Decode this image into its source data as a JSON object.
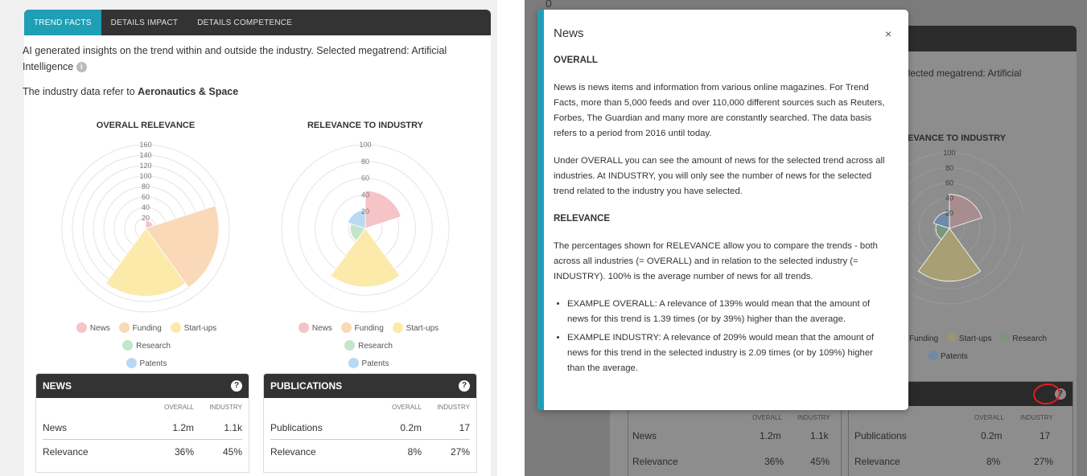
{
  "left": {
    "tabs": [
      {
        "label": "TREND FACTS",
        "active": true
      },
      {
        "label": "DETAILS IMPACT",
        "active": false
      },
      {
        "label": "DETAILS COMPETENCE",
        "active": false
      }
    ],
    "intro": "AI generated insights on the trend within and outside the industry. Selected megatrend: Artificial Intelligence",
    "info_icon": "i",
    "industry_prefix": "The industry data refer to ",
    "industry_name": "Aeronautics & Space",
    "chart_titles": {
      "overall": "OVERALL RELEVANCE",
      "industry": "RELEVANCE TO INDUSTRY"
    },
    "legend": [
      "News",
      "Funding",
      "Start-ups",
      "Research",
      "Patents"
    ],
    "news_box": {
      "title": "NEWS",
      "help_icon": "?",
      "col_overall": "OVERALL",
      "col_industry": "INDUSTRY",
      "rows": [
        {
          "label": "News",
          "overall": "1.2m",
          "industry": "1.1k"
        },
        {
          "label": "Relevance",
          "overall": "36%",
          "industry": "45%"
        }
      ]
    },
    "pub_box": {
      "title": "PUBLICATIONS",
      "help_icon": "?",
      "col_overall": "OVERALL",
      "col_industry": "INDUSTRY",
      "rows": [
        {
          "label": "Publications",
          "overall": "0.2m",
          "industry": "17"
        },
        {
          "label": "Relevance",
          "overall": "8%",
          "industry": "27%"
        }
      ]
    }
  },
  "colors": {
    "accent": "#1f9fb5",
    "news": "#f6c3c6",
    "funding": "#f9d9b8",
    "startups": "#fbeaa9",
    "research": "#c3e5c8",
    "patents": "#b9d8f2",
    "dark": "#333333"
  },
  "chart_data": [
    {
      "type": "polar-area",
      "title": "OVERALL RELEVANCE",
      "categories": [
        "News",
        "Funding",
        "Start-ups",
        "Research",
        "Patents"
      ],
      "values": [
        15,
        140,
        130,
        0,
        0
      ],
      "rlim": [
        0,
        160
      ],
      "ticks": [
        "20",
        "40",
        "60",
        "80",
        "100",
        "120",
        "140",
        "160"
      ]
    },
    {
      "type": "polar-area",
      "title": "RELEVANCE TO INDUSTRY",
      "categories": [
        "News",
        "Funding",
        "Start-ups",
        "Research",
        "Patents"
      ],
      "values": [
        45,
        0,
        70,
        18,
        22
      ],
      "rlim": [
        0,
        100
      ],
      "ticks": [
        "20",
        "40",
        "60",
        "80",
        "100"
      ]
    }
  ],
  "right": {
    "zero": "0",
    "bg_text_megatrend": "elected megatrend: Artificial",
    "bg_text_relevance": "EVANCE TO INDUSTRY",
    "bg_ticks": [
      "100",
      "80",
      "60",
      "40",
      "20"
    ],
    "bg_legend": [
      "Funding",
      "Start-ups",
      "Research",
      "Patents"
    ],
    "bg_box_title_tail": "S",
    "bg_help_icon": "?",
    "bg_col_overall": "OVERALL",
    "bg_col_industry": "INDUSTRY",
    "bg_news_rows": [
      {
        "label": "News",
        "overall": "1.2m",
        "industry": "1.1k"
      },
      {
        "label": "Relevance",
        "overall": "36%",
        "industry": "45%"
      }
    ],
    "bg_pub_rows": [
      {
        "label": "Publications",
        "overall": "0.2m",
        "industry": "17"
      },
      {
        "label": "Relevance",
        "overall": "8%",
        "industry": "27%"
      }
    ],
    "modal": {
      "title": "News",
      "close": "×",
      "h_overall": "OVERALL",
      "p1": "News is news items and information from various online magazines.  For Trend Facts, more than 5,000 feeds and over 110,000 different sources such as Reuters, Forbes, The Guardian and many more are constantly searched. The data basis refers to a period from 2016 until today.",
      "p2": "Under OVERALL you can see the amount of news for the selected trend across all industries. At INDUSTRY, you will only see the number of news for the selected trend related to the industry you have selected.",
      "h_relevance": "RELEVANCE",
      "p3": "The percentages shown for RELEVANCE allow you to compare the trends - both across all industries (= OVERALL) and in relation to the selected industry (= INDUSTRY). 100% is the average number of news for all trends.",
      "b1": "EXAMPLE OVERALL: A relevance of 139% would mean that the amount of news for this trend is 1.39 times (or by 39%) higher than the average.",
      "b2": "EXAMPLE INDUSTRY: A relevance of 209% would mean that the amount of news for this trend in the selected industry is 2.09 times (or by 109%) higher than the average."
    }
  }
}
